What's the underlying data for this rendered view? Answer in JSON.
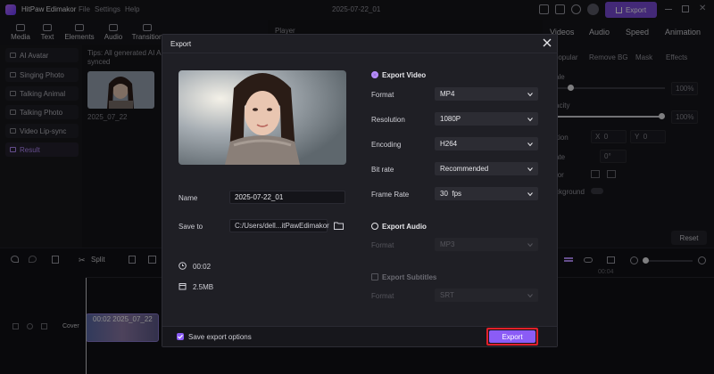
{
  "app": {
    "title": "HitPaw Edimakor",
    "menus": [
      "File",
      "Settings",
      "Help"
    ],
    "doc_title": "2025-07-22_01",
    "export_label": "Export"
  },
  "toolbar": {
    "items": [
      "Media",
      "Text",
      "Elements",
      "Audio",
      "Transition"
    ]
  },
  "sidebar": {
    "items": [
      {
        "label": "AI Avatar"
      },
      {
        "label": "Singing Photo"
      },
      {
        "label": "Talking Animal"
      },
      {
        "label": "Talking Photo"
      },
      {
        "label": "Video Lip-sync"
      },
      {
        "label": "Result"
      }
    ]
  },
  "media": {
    "tips": "Tips: All generated AI A",
    "tips_line2": "synced",
    "thumb_label": "2025_07_22"
  },
  "player": {
    "label": "Player"
  },
  "right_panel": {
    "tabs": [
      "Videos",
      "Audio",
      "Speed",
      "Animation"
    ],
    "subtabs": [
      "Popular",
      "Remove BG",
      "Mask",
      "Effects"
    ],
    "scale_label": "ale",
    "scale_pct": "100%",
    "opacity_label": "acity",
    "opacity_pct": "100%",
    "position_label": "ition",
    "pos_x_label": "X",
    "pos_x": "0",
    "pos_y_label": "Y",
    "pos_y": "0",
    "rotate_label": "ate",
    "rotate_value": "0°",
    "mirror_label": "ror",
    "background_label": "ckground",
    "reset_label": "Reset"
  },
  "timeline": {
    "split_label": "Split",
    "ruler_mark": "00:04",
    "cover_label": "Cover",
    "clip_label": "00:02 2025_07_22"
  },
  "export_dialog": {
    "title": "Export",
    "name_label": "Name",
    "name_value": "2025-07-22_01",
    "save_to_label": "Save to",
    "save_to_value": "C:/Users/dell...itPawEdimakor",
    "duration": "00:02",
    "size": "2.5MB",
    "export_video_label": "Export Video",
    "format_label": "Format",
    "format_value": "MP4",
    "resolution_label": "Resolution",
    "resolution_value": "1080P",
    "encoding_label": "Encoding",
    "encoding_value": "H264",
    "bitrate_label": "Bit rate",
    "bitrate_value": "Recommended",
    "framerate_label": "Frame Rate",
    "framerate_value": "30  fps",
    "export_audio_label": "Export Audio",
    "audio_format_label": "Format",
    "audio_format_value": "MP3",
    "export_subtitles_label": "Export Subtitles",
    "subtitle_format_label": "Format",
    "subtitle_format_value": "SRT",
    "save_options_label": "Save export options",
    "export_button_label": "Export"
  },
  "colors": {
    "accent": "#8b5cf6",
    "highlight_frame": "#e0202a"
  }
}
